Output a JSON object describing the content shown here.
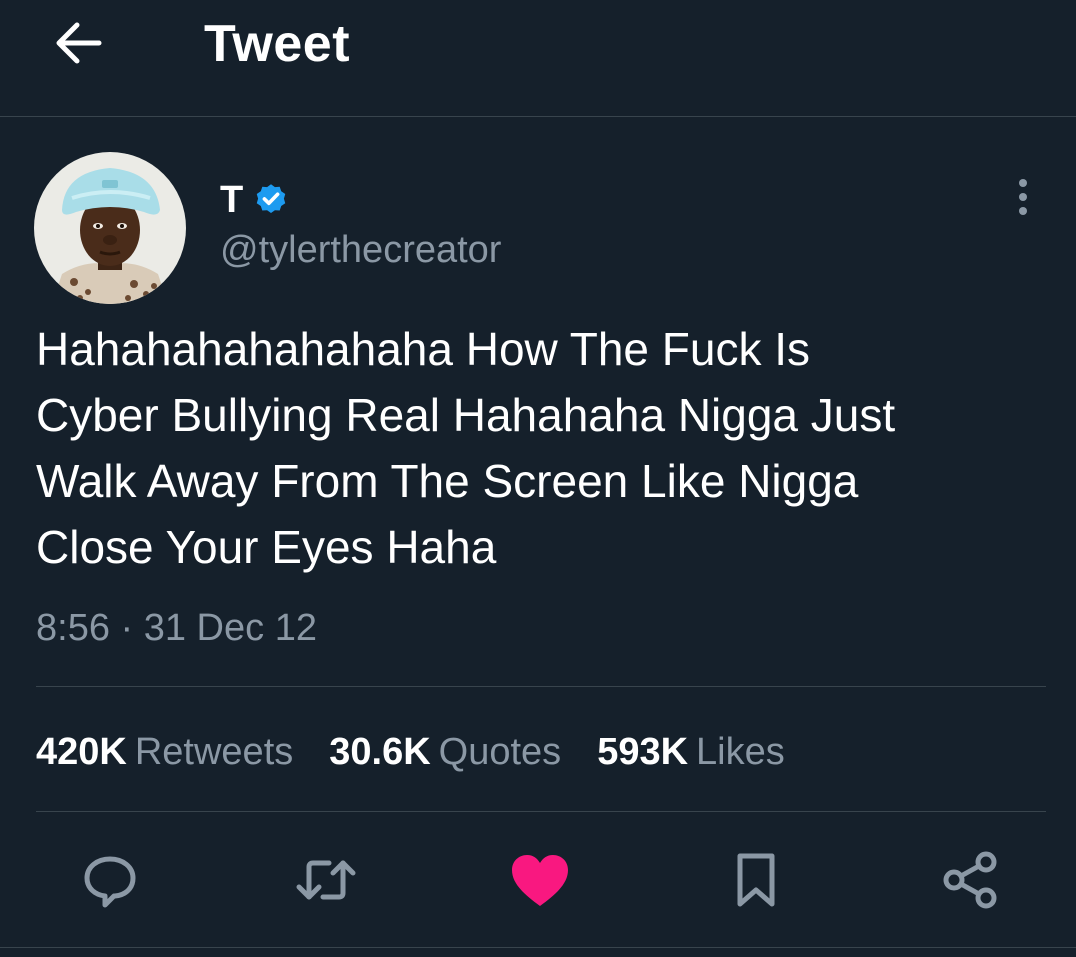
{
  "header": {
    "title": "Tweet",
    "back_icon": "arrow-left-icon"
  },
  "author": {
    "display_name": "T",
    "handle": "@tylerthecreator",
    "verified": true,
    "verified_color": "#1d9bf0"
  },
  "tweet": {
    "text": "Hahahahahahahaha How The Fuck Is\nCyber Bullying Real Hahahaha Nigga Just\nWalk Away From The Screen Like Nigga\nClose Your Eyes Haha",
    "timestamp": "8:56 · 31 Dec 12"
  },
  "stats": {
    "retweets": {
      "count": "420K",
      "label": "Retweets"
    },
    "quotes": {
      "count": "30.6K",
      "label": "Quotes"
    },
    "likes": {
      "count": "593K",
      "label": "Likes"
    }
  },
  "actions": [
    {
      "name": "reply",
      "icon": "reply-icon",
      "active": false
    },
    {
      "name": "retweet",
      "icon": "retweet-icon",
      "active": false
    },
    {
      "name": "like",
      "icon": "heart-icon",
      "active": true
    },
    {
      "name": "bookmark",
      "icon": "bookmark-icon",
      "active": false
    },
    {
      "name": "share",
      "icon": "share-icon",
      "active": false
    }
  ],
  "colors": {
    "background": "#15202b",
    "text_primary": "#ffffff",
    "text_secondary": "#8b98a5",
    "divider": "#38444d",
    "like_active": "#f91880",
    "icon_default": "#8b98a5"
  }
}
